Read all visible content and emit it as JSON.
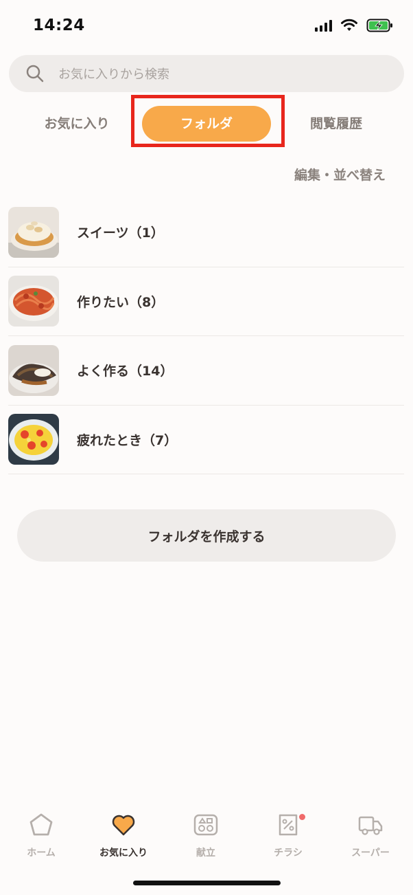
{
  "status_bar": {
    "time": "14:24"
  },
  "search": {
    "placeholder": "お気に入りから検索"
  },
  "tabs": [
    {
      "label": "お気に入り",
      "active": false
    },
    {
      "label": "フォルダ",
      "active": true
    },
    {
      "label": "閲覧履歴",
      "active": false
    }
  ],
  "edit_sort_label": "編集・並べ替え",
  "folders": [
    {
      "label": "スイーツ（1）",
      "image": "meringue-tart"
    },
    {
      "label": "作りたい（8）",
      "image": "tomato-pasta"
    },
    {
      "label": "よく作る（14）",
      "image": "grilled-fish"
    },
    {
      "label": "疲れたとき（7）",
      "image": "egg-tomato-stirfry"
    }
  ],
  "create_folder_label": "フォルダを作成する",
  "bottom_nav": [
    {
      "label": "ホーム",
      "icon": "home-icon",
      "active": false
    },
    {
      "label": "お気に入り",
      "icon": "heart-icon",
      "active": true
    },
    {
      "label": "献立",
      "icon": "menu-plan-icon",
      "active": false
    },
    {
      "label": "チラシ",
      "icon": "flyer-icon",
      "active": false,
      "badge": true
    },
    {
      "label": "スーパー",
      "icon": "truck-icon",
      "active": false
    }
  ],
  "colors": {
    "accent": "#f8a94a",
    "highlight": "#e8261c",
    "badge": "#f06a6a"
  }
}
